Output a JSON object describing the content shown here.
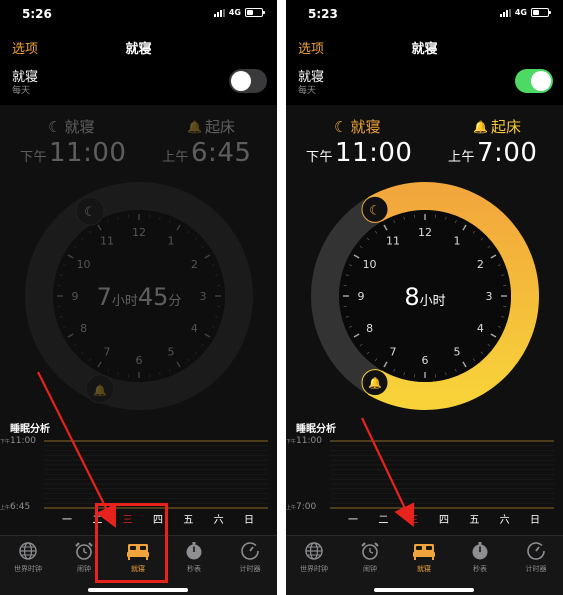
{
  "left": {
    "status_time": "5:26",
    "network": "4G",
    "nav_options": "选项",
    "nav_title": "就寝",
    "row_title": "就寝",
    "row_subtitle": "每天",
    "toggle_on": false,
    "bedtime_label": "就寝",
    "wake_label": "起床",
    "bedtime_prefix": "下午",
    "bedtime_time": "11:00",
    "wake_prefix": "上午",
    "wake_time": "6:45",
    "duration": {
      "h": "7",
      "h_unit": "小时",
      "m": "45",
      "m_unit": "分"
    },
    "analysis_title": "睡眠分析",
    "chart_top_prefix": "下午",
    "chart_top_time": "11:00",
    "chart_bottom_prefix": "上午",
    "chart_bottom_time": "6:45",
    "days": [
      "一",
      "二",
      "三",
      "四",
      "五",
      "六",
      "日"
    ],
    "highlight_day_index": 2
  },
  "right": {
    "status_time": "5:23",
    "network": "4G",
    "nav_options": "选项",
    "nav_title": "就寝",
    "row_title": "就寝",
    "row_subtitle": "每天",
    "toggle_on": true,
    "bedtime_label": "就寝",
    "wake_label": "起床",
    "bedtime_prefix": "下午",
    "bedtime_time": "11:00",
    "wake_prefix": "上午",
    "wake_time": "7:00",
    "duration": {
      "h": "8",
      "h_unit": "小时"
    },
    "analysis_title": "睡眠分析",
    "chart_top_prefix": "下午",
    "chart_top_time": "11:00",
    "chart_bottom_prefix": "上午",
    "chart_bottom_time": "7:00",
    "days": [
      "一",
      "二",
      "三",
      "四",
      "五",
      "六",
      "日"
    ],
    "highlight_day_index": 2
  },
  "clock_numbers": [
    "12",
    "1",
    "2",
    "3",
    "4",
    "5",
    "6",
    "7",
    "8",
    "9",
    "10",
    "11"
  ],
  "tabs": [
    {
      "label": "世界时钟",
      "icon": "globe-icon"
    },
    {
      "label": "闹钟",
      "icon": "alarm-clock-icon"
    },
    {
      "label": "就寝",
      "icon": "bed-icon",
      "active": true
    },
    {
      "label": "秒表",
      "icon": "stopwatch-icon"
    },
    {
      "label": "计时器",
      "icon": "timer-icon"
    }
  ],
  "colors": {
    "accent": "#f1a33c",
    "arc_start": "#f2a73c",
    "arc_end": "#f7d239",
    "toggle_on": "#4cd964",
    "highlight": "#e8231d",
    "annotation": "#e8231d"
  }
}
